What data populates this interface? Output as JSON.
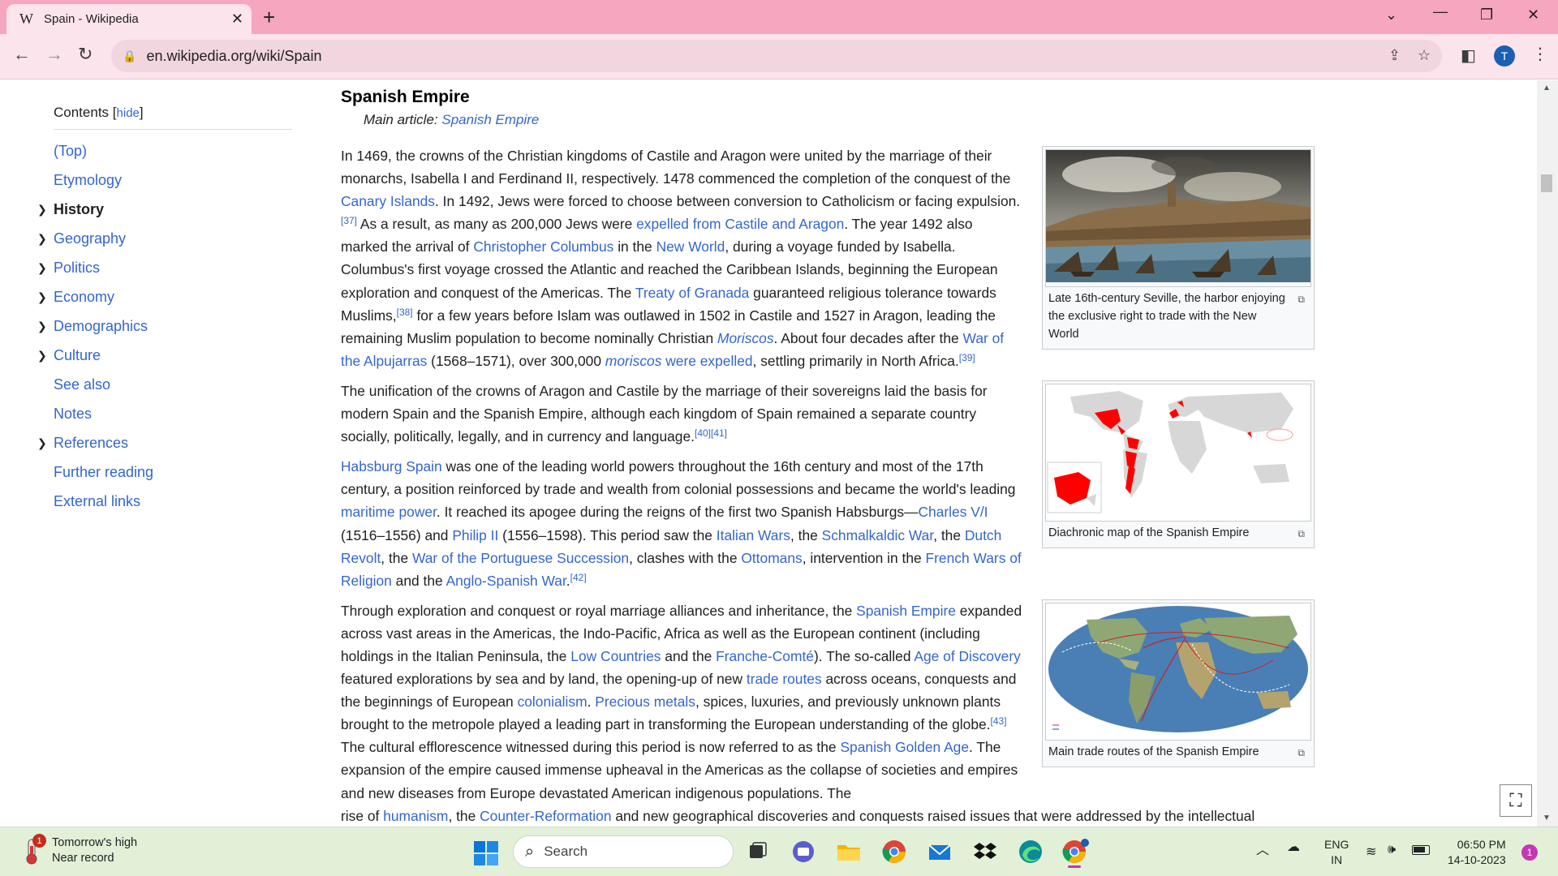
{
  "browser": {
    "tab_title": "Spain - Wikipedia",
    "tab_favicon": "W",
    "url": "en.wikipedia.org/wiki/Spain",
    "profile_initial": "T",
    "accent": "#f7a6bf"
  },
  "toc": {
    "title": "Contents",
    "hide_label": "hide",
    "items": [
      {
        "label": "(Top)",
        "expandable": false,
        "active": false
      },
      {
        "label": "Etymology",
        "expandable": false,
        "active": false
      },
      {
        "label": "History",
        "expandable": true,
        "active": true
      },
      {
        "label": "Geography",
        "expandable": true,
        "active": false
      },
      {
        "label": "Politics",
        "expandable": true,
        "active": false
      },
      {
        "label": "Economy",
        "expandable": true,
        "active": false
      },
      {
        "label": "Demographics",
        "expandable": true,
        "active": false
      },
      {
        "label": "Culture",
        "expandable": true,
        "active": false
      },
      {
        "label": "See also",
        "expandable": false,
        "active": false
      },
      {
        "label": "Notes",
        "expandable": false,
        "active": false
      },
      {
        "label": "References",
        "expandable": true,
        "active": false
      },
      {
        "label": "Further reading",
        "expandable": false,
        "active": false
      },
      {
        "label": "External links",
        "expandable": false,
        "active": false
      }
    ]
  },
  "article": {
    "heading": "Spanish Empire",
    "hatnote_prefix": "Main article:",
    "hatnote_link": "Spanish Empire",
    "paragraphs": [
      [
        {
          "t": "In 1469, the crowns of the Christian kingdoms of Castile and Aragon were united by the marriage of their monarchs, Isabella I and Ferdinand II, respectively. 1478 commenced the completion of the conquest of the "
        },
        {
          "t": "Canary Islands",
          "link": true
        },
        {
          "t": ". In 1492, Jews were forced to choose between conversion to Catholicism or facing expulsion."
        },
        {
          "t": "[37]",
          "sup": true
        },
        {
          "t": " As a result, as many as 200,000 Jews were "
        },
        {
          "t": "expelled from Castile and Aragon",
          "link": true
        },
        {
          "t": ". The year 1492 also marked the arrival of "
        },
        {
          "t": "Christopher Columbus",
          "link": true
        },
        {
          "t": " in the "
        },
        {
          "t": "New World",
          "link": true
        },
        {
          "t": ", during a voyage funded by Isabella. Columbus's first voyage crossed the Atlantic and reached the Caribbean Islands, beginning the European exploration and conquest of the Americas. The "
        },
        {
          "t": "Treaty of Granada",
          "link": true
        },
        {
          "t": " guaranteed religious tolerance towards Muslims,"
        },
        {
          "t": "[38]",
          "sup": true
        },
        {
          "t": " for a few years before Islam was outlawed in 1502 in Castile and 1527 in Aragon, leading the remaining Muslim population to become nominally Christian "
        },
        {
          "t": "Moriscos",
          "link": true,
          "italic": true
        },
        {
          "t": ". About four decades after the "
        },
        {
          "t": "War of the Alpujarras",
          "link": true
        },
        {
          "t": " (1568–1571), over 300,000 "
        },
        {
          "t": "moriscos",
          "link": true,
          "italic": true
        },
        {
          "t": " were expelled",
          "link": true
        },
        {
          "t": ", settling primarily in North Africa."
        },
        {
          "t": "[39]",
          "sup": true
        }
      ],
      [
        {
          "t": "The unification of the crowns of Aragon and Castile by the marriage of their sovereigns laid the basis for modern Spain and the Spanish Empire, although each kingdom of Spain remained a separate country socially, politically, legally, and in currency and language."
        },
        {
          "t": "[40][41]",
          "sup": true
        }
      ],
      [
        {
          "t": "Habsburg Spain",
          "link": true
        },
        {
          "t": " was one of the leading world powers throughout the 16th century and most of the 17th century, a position reinforced by trade and wealth from colonial possessions and became the world's leading "
        },
        {
          "t": "maritime power",
          "link": true
        },
        {
          "t": ". It reached its apogee during the reigns of the first two Spanish Habsburgs—"
        },
        {
          "t": "Charles V/I",
          "link": true
        },
        {
          "t": " (1516–1556) and "
        },
        {
          "t": "Philip II",
          "link": true
        },
        {
          "t": " (1556–1598). This period saw the "
        },
        {
          "t": "Italian Wars",
          "link": true
        },
        {
          "t": ", the "
        },
        {
          "t": "Schmalkaldic War",
          "link": true
        },
        {
          "t": ", the "
        },
        {
          "t": "Dutch Revolt",
          "link": true
        },
        {
          "t": ", the "
        },
        {
          "t": "War of the Portuguese Succession",
          "link": true
        },
        {
          "t": ", clashes with the "
        },
        {
          "t": "Ottomans",
          "link": true
        },
        {
          "t": ", intervention in the "
        },
        {
          "t": "French Wars of Religion",
          "link": true
        },
        {
          "t": " and the "
        },
        {
          "t": "Anglo-Spanish War",
          "link": true
        },
        {
          "t": ".",
          "link": false
        },
        {
          "t": "[42]",
          "sup": true
        }
      ],
      [
        {
          "t": "Through exploration and conquest or royal marriage alliances and inheritance, the "
        },
        {
          "t": "Spanish Empire",
          "link": true
        },
        {
          "t": " expanded across vast areas in the Americas, the Indo-Pacific, Africa as well as the European continent (including holdings in the Italian Peninsula, the "
        },
        {
          "t": "Low Countries",
          "link": true
        },
        {
          "t": " and the "
        },
        {
          "t": "Franche-Comté",
          "link": true
        },
        {
          "t": "). The so-called "
        },
        {
          "t": "Age of Discovery",
          "link": true
        },
        {
          "t": " featured explorations by sea and by land, the opening-up of new "
        },
        {
          "t": "trade routes",
          "link": true
        },
        {
          "t": " across oceans, conquests and the beginnings of European "
        },
        {
          "t": "colonialism",
          "link": true
        },
        {
          "t": ". "
        },
        {
          "t": "Precious metals",
          "link": true
        },
        {
          "t": ", spices, luxuries, and previously unknown plants brought to the metropole played a leading part in transforming the European understanding of the globe."
        },
        {
          "t": "[43]",
          "sup": true
        },
        {
          "t": " The cultural efflorescence witnessed during this period is now referred to as the "
        },
        {
          "t": "Spanish Golden Age",
          "link": true
        },
        {
          "t": ". The expansion of the empire caused immense upheaval in the Americas as the collapse of societies and empires and new diseases from Europe devastated American indigenous populations. The"
        }
      ],
      [
        {
          "t": "rise of "
        },
        {
          "t": "humanism",
          "link": true
        },
        {
          "t": ", the "
        },
        {
          "t": "Counter-Reformation",
          "link": true
        },
        {
          "t": " and new geographical discoveries and conquests raised issues that were addressed by the intellectual"
        }
      ]
    ],
    "figures": [
      {
        "caption": "Late 16th-century Seville, the harbor enjoying the exclusive right to trade with the New World",
        "icon": "enlarge-icon"
      },
      {
        "caption": "Diachronic map of the Spanish Empire",
        "icon": "enlarge-icon"
      },
      {
        "caption": "Main trade routes of the Spanish Empire",
        "icon": "enlarge-icon"
      }
    ]
  },
  "taskbar": {
    "weather_line1": "Tomorrow's high",
    "weather_line2": "Near record",
    "weather_badge": "1",
    "search_label": "Search",
    "lang_line1": "ENG",
    "lang_line2": "IN",
    "time": "06:50 PM",
    "date": "14-10-2023",
    "notification_count": "1"
  }
}
